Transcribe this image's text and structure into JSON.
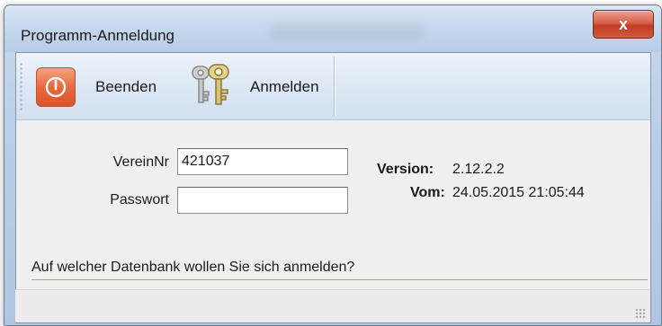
{
  "window": {
    "title": "Programm-Anmeldung",
    "close_glyph": "x"
  },
  "toolbar": {
    "exit_label": "Beenden",
    "exit_icon": "power-icon",
    "login_label": "Anmelden",
    "login_icon": "keys-icon"
  },
  "form": {
    "club_label": "VereinNr",
    "club_value": "421037",
    "password_label": "Passwort",
    "password_value": ""
  },
  "info": {
    "version_label": "Version:",
    "version_value": "2.12.2.2",
    "date_label": "Vom:",
    "date_value": "24.05.2015 21:05:44"
  },
  "prompt": {
    "question": "Auf welcher Datenbank wollen Sie sich anmelden?"
  },
  "colors": {
    "accent": "#d9532b",
    "close": "#c23b25",
    "title_frame": "#b9cde6"
  }
}
